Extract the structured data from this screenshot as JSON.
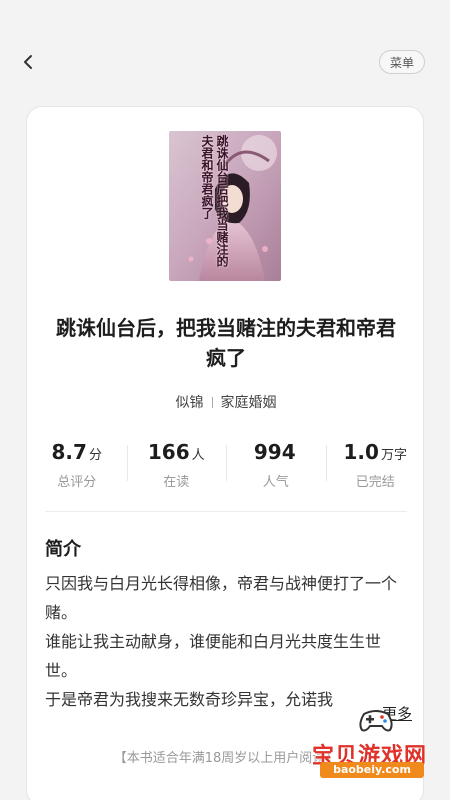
{
  "header": {
    "back_icon": "chevron-left-icon",
    "menu_label": "菜单"
  },
  "book": {
    "title": "跳诛仙台后，把我当赌注的夫君和帝君疯了",
    "author": "似锦",
    "category": "家庭婚姻",
    "cover_text": {
      "main": "跳诛仙台后把我当赌注的夫君和帝君疯了"
    }
  },
  "stats": [
    {
      "value": "8.7",
      "unit": "分",
      "label": "总评分"
    },
    {
      "value": "166",
      "unit": "人",
      "label": "在读"
    },
    {
      "value": "994",
      "unit": "",
      "label": "人气"
    },
    {
      "value": "1.0",
      "unit": "万字",
      "label": "已完结"
    }
  ],
  "intro": {
    "heading": "简介",
    "paragraphs": [
      "只因我与白月光长得相像，帝君与战神便打了一个赌。",
      "谁能让我主动献身，谁便能和白月光共度生生世世。",
      "于是帝君为我搜来无数奇珍异宝，允诺我"
    ],
    "more_label": "更多"
  },
  "notice": "【本书适合年满18周岁以上用户阅读】",
  "watermark": {
    "text": "宝贝游戏网",
    "url": "baobeiy.com"
  },
  "colors": {
    "background": "#f3f3f3",
    "card": "#ffffff",
    "watermark_red": "#e0312b",
    "watermark_orange": "#f08a1d"
  }
}
